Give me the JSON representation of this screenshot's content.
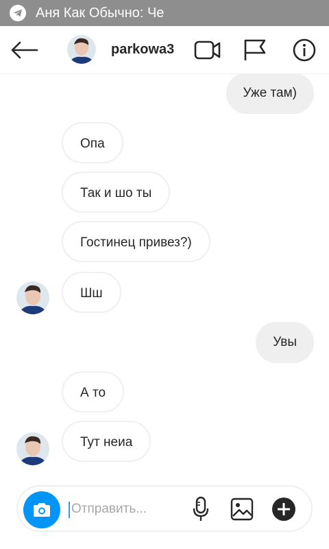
{
  "status_bar": {
    "notification": "Аня Как Обычно: Че"
  },
  "header": {
    "username": "parkowa3",
    "icons": [
      "back-arrow-icon",
      "video-call-icon",
      "flag-icon",
      "info-icon"
    ]
  },
  "messages": [
    {
      "direction": "outgoing",
      "text": "Уже там)"
    },
    {
      "direction": "incoming",
      "text": "Опа"
    },
    {
      "direction": "incoming",
      "text": "Так и шо ты"
    },
    {
      "direction": "incoming",
      "text": "Гостинец привез?)"
    },
    {
      "direction": "incoming",
      "text": "Шш"
    },
    {
      "direction": "outgoing",
      "text": "Увы"
    },
    {
      "direction": "incoming",
      "text": "А то"
    },
    {
      "direction": "incoming",
      "text": "Тут неиа"
    }
  ],
  "composer": {
    "placeholder": "Отправить...",
    "value": "",
    "icons": [
      "camera-icon",
      "microphone-icon",
      "gallery-icon",
      "plus-icon"
    ]
  },
  "colors": {
    "accent": "#0095f6",
    "status_bar": "#8e8e8e",
    "outgoing_bubble": "#efefef",
    "incoming_border": "#efefef"
  }
}
